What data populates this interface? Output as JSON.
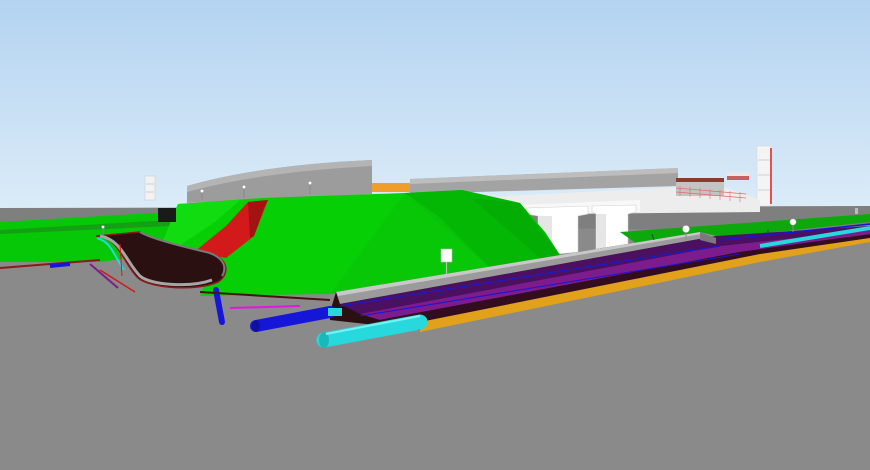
{
  "viewport": {
    "kind": "3d-model-view",
    "colors": {
      "sky_top": "#b3d3f1",
      "sky_bottom": "#dcecf8",
      "ground": "#8a8a8a",
      "embankment": "#06cf06",
      "embankment_shadow": "#049f04",
      "red_slope": "#d21a1a",
      "road_surface": "#2a1010",
      "road_edge": "#9b9b9b",
      "stadium_wall": "#9c9c9c",
      "bridge_deck": "#ededed",
      "pier": "#ffffff",
      "utility_cyan": "#27d9dc",
      "utility_blue": "#1616d8",
      "utility_purple": "#7d1c8c",
      "utility_orange": "#e2a11a",
      "accent_orange": "#ef9e2d"
    },
    "icons": [
      "lamp-post-icon",
      "sign-icon",
      "building-icon"
    ]
  }
}
